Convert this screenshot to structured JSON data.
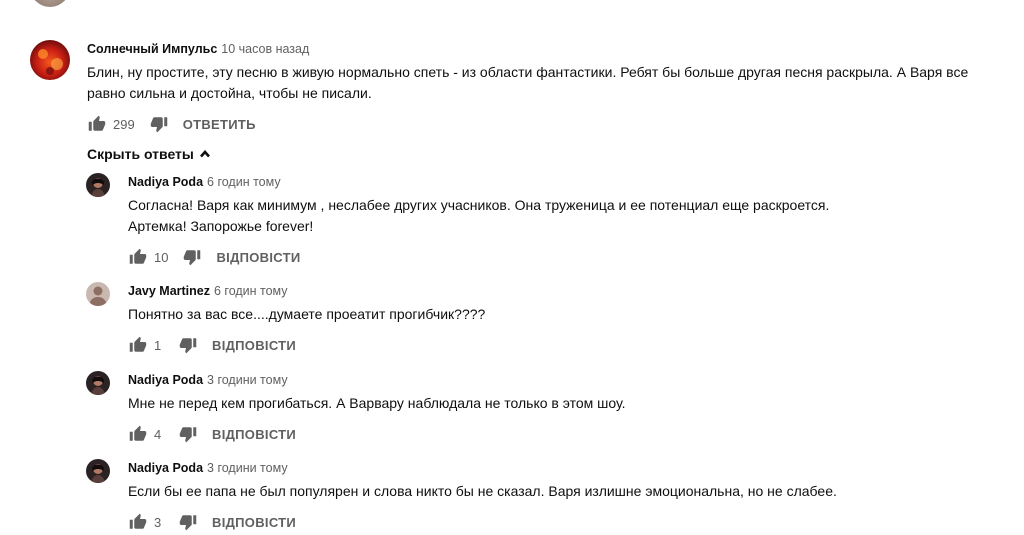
{
  "comment": {
    "author": "Солнечный Импульс",
    "time": "10 часов назад",
    "text": "Блин, ну простите, эту песню в живую нормально спеть - из области фантастики. Ребят бы больше другая песня раскрыла. А Варя все равно сильна и достойна, чтобы не писали.",
    "likes": "299",
    "reply_label": "ОТВЕТИТЬ"
  },
  "replies_toggle_label": "Скрыть ответы",
  "replies": [
    {
      "author": "Nadiya Poda",
      "time": "6 годин тому",
      "text_lines": [
        "Согласна! Варя как минимум , неслабее других учасников. Она труженица и ее потенциал еще раскроется.",
        "Артемка! Запорожье forever!"
      ],
      "likes": "10",
      "reply_label": "ВІДПОВІСТИ"
    },
    {
      "author": "Javy Martinez",
      "time": "6 годин тому",
      "text_lines": [
        "Понятно за вас все....думаете проеатит прогибчик????"
      ],
      "likes": "1",
      "reply_label": "ВІДПОВІСТИ"
    },
    {
      "author": "Nadiya Poda",
      "time": "3 години тому",
      "text_lines": [
        "Мне не перед кем прогибаться. А Варвару наблюдала не только в этом шоу."
      ],
      "likes": "4",
      "reply_label": "ВІДПОВІСТИ"
    },
    {
      "author": "Nadiya Poda",
      "time": "3 години тому",
      "text_lines": [
        "Если бы ее папа не был популярен и слова никто бы не сказал.  Варя излишне эмоциональна, но не слабее."
      ],
      "likes": "3",
      "reply_label": "ВІДПОВІСТИ"
    }
  ]
}
